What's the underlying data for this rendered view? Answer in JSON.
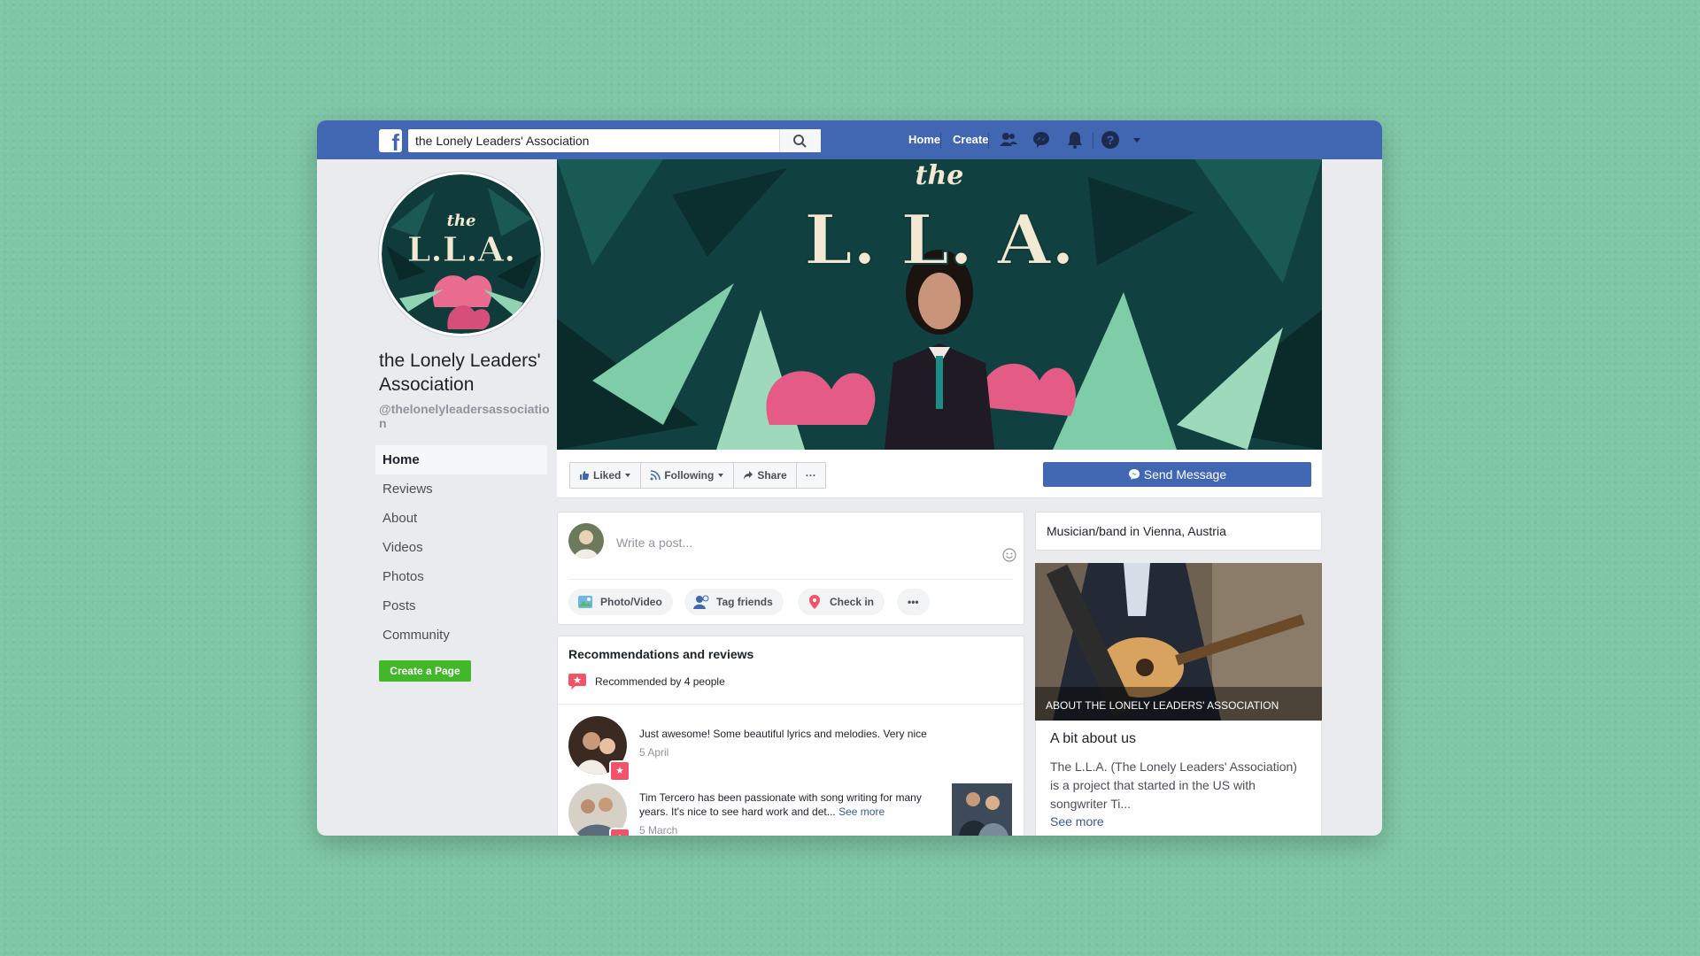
{
  "topbar": {
    "logo_letter": "f",
    "search_value": "the Lonely Leaders' Association",
    "nav": [
      "Home",
      "Create"
    ],
    "icons": [
      "friends-icon",
      "messenger-icon",
      "notifications-icon",
      "help-icon",
      "caret-down-icon"
    ]
  },
  "profile": {
    "logo_small": "the",
    "logo_big": "L.L.A.",
    "name": "the Lonely Leaders' Association",
    "handle": "@thelonelyleadersassociation"
  },
  "sidebar": {
    "items": [
      {
        "label": "Home",
        "active": true
      },
      {
        "label": "Reviews"
      },
      {
        "label": "About"
      },
      {
        "label": "Videos"
      },
      {
        "label": "Photos"
      },
      {
        "label": "Posts"
      },
      {
        "label": "Community"
      }
    ],
    "create_page": "Create a Page"
  },
  "cover": {
    "small_text": "the",
    "big_text": "L. L. A."
  },
  "actions": {
    "liked": "Liked",
    "following": "Following",
    "share": "Share",
    "more": "···",
    "send_message": "Send Message"
  },
  "composer": {
    "placeholder": "Write a post...",
    "buttons": [
      "Photo/Video",
      "Tag friends",
      "Check in"
    ],
    "more": "•••"
  },
  "reviews": {
    "title": "Recommendations and reviews",
    "recommended": "Recommended by 4 people",
    "items": [
      {
        "text": "Just awesome! Some beautiful lyrics and melodies. Very nice",
        "date": "5 April"
      },
      {
        "text_line1": "Tim Tercero has been passionate with song writing for many",
        "text_line2": "years. It's nice to see hard work and det...",
        "see_more": "See more",
        "date": "5 March"
      }
    ]
  },
  "right": {
    "category": "Musician/band in Vienna, Austria",
    "about_caption": "ABOUT THE LONELY LEADERS' ASSOCIATION",
    "about_title": "A bit about us",
    "about_text": "The L.L.A. (The Lonely Leaders' Association) is a project that started in the US with songwriter Ti...",
    "see_more": "See more"
  },
  "colors": {
    "background": "#7fc7a6",
    "brand": "#4267b2",
    "create_green": "#42b72a",
    "review_red": "#f35369"
  }
}
